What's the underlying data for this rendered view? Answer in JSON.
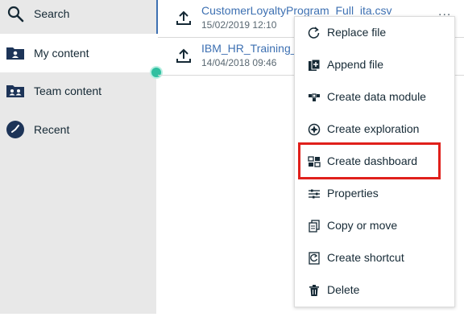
{
  "sidebar": {
    "items": [
      {
        "label": "Search",
        "icon": "search-icon"
      },
      {
        "label": "My content",
        "icon": "folder-user-icon"
      },
      {
        "label": "Team content",
        "icon": "folder-team-icon"
      },
      {
        "label": "Recent",
        "icon": "recent-icon"
      }
    ],
    "active_index": 1
  },
  "files": [
    {
      "name": "CustomerLoyaltyProgram_Full_ita.csv",
      "date": "15/02/2019 12:10",
      "icon": "upload-icon"
    },
    {
      "name": "IBM_HR_Training_S",
      "date": "14/04/2018 09:46",
      "icon": "upload-icon"
    }
  ],
  "more_icon": "...",
  "menu": {
    "items": [
      {
        "label": "Replace file",
        "icon": "replace-icon"
      },
      {
        "label": "Append file",
        "icon": "append-icon"
      },
      {
        "label": "Create data module",
        "icon": "data-module-icon"
      },
      {
        "label": "Create exploration",
        "icon": "exploration-icon"
      },
      {
        "label": "Create dashboard",
        "icon": "dashboard-icon"
      },
      {
        "label": "Properties",
        "icon": "properties-icon"
      },
      {
        "label": "Copy or move",
        "icon": "copy-icon"
      },
      {
        "label": "Create shortcut",
        "icon": "shortcut-icon"
      },
      {
        "label": "Delete",
        "icon": "trash-icon"
      }
    ],
    "highlighted": "Create dashboard"
  },
  "colors": {
    "accent": "#3d70b2",
    "highlight": "#e0201b",
    "status": "#2fbfa0",
    "sidebar_bg": "#e8e8e8"
  }
}
